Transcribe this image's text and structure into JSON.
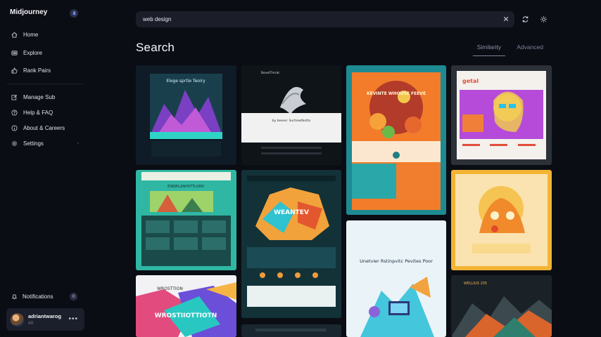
{
  "sidebar": {
    "brand": "Midjourney",
    "main_items": [
      {
        "label": "Home",
        "icon": "home-icon"
      },
      {
        "label": "Explore",
        "icon": "explore-icon"
      },
      {
        "label": "Rank Pairs",
        "icon": "thumbs-up-icon"
      }
    ],
    "secondary_items": [
      {
        "label": "Manage Sub",
        "icon": "edit-icon"
      },
      {
        "label": "Help & FAQ",
        "icon": "help-icon"
      },
      {
        "label": "About & Careers",
        "icon": "info-icon"
      },
      {
        "label": "Settings",
        "icon": "gear-icon"
      }
    ],
    "notifications": {
      "label": "Notifications",
      "count": "0"
    },
    "user": {
      "name": "adriantwarog",
      "tag": "#0"
    }
  },
  "search": {
    "value": "web design"
  },
  "page": {
    "title": "Search",
    "tabs": [
      {
        "label": "Similarity",
        "active": true
      },
      {
        "label": "Advanced",
        "active": false
      }
    ]
  },
  "results": [
    {
      "title": "Elege sprtie Teoiry"
    },
    {
      "title": "BevelTmrat",
      "subtitle": "by beeee: Surtiowtbotto"
    },
    {
      "title": "KEVINTE WHOUSE FEEVE"
    },
    {
      "title": "getal"
    },
    {
      "title": "ENRIPLANHSTTLORN"
    },
    {
      "title": "WEANTEV"
    },
    {
      "title": "Unetvier Rstinpvitc Pevites Poor"
    },
    {
      "title": ""
    },
    {
      "title": "WROSTTION",
      "subtitle": "WROSTIIOTTIOTN"
    },
    {
      "title": ""
    },
    {
      "title": "WELLIUS 205"
    }
  ]
}
